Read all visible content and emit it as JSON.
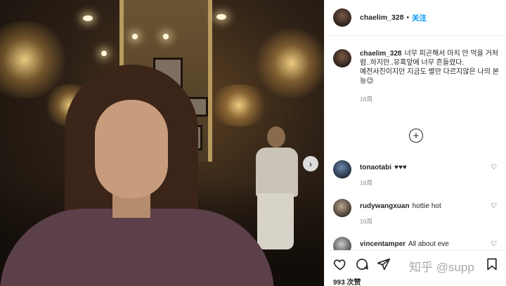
{
  "post": {
    "username": "chaelim_328",
    "separator": "•",
    "follow_label": "关注",
    "caption_lines": [
      "너무 피곤해서 마치 안 먹을 거처럼..하지만..유혹앞에 너무 흔들렸다.",
      "예전사진이지만 지금도 별만 다르지않은 나의 본능😉"
    ],
    "time": "16周"
  },
  "comments": [
    {
      "username": "tonaotabi",
      "text": "♥♥♥",
      "time": "16周"
    },
    {
      "username": "rudywangxuan",
      "text": "hottie hot",
      "time": "16周"
    },
    {
      "username": "vincentamper",
      "text": "All about eve",
      "time": ""
    }
  ],
  "actions": {
    "likes": "993 次赞",
    "watermark": "知乎 @supp"
  },
  "icons": {
    "next": "chevron-right-icon",
    "add": "plus-circle-icon",
    "like": "heart-icon",
    "comment": "comment-icon",
    "share": "paper-plane-icon",
    "save": "bookmark-icon"
  },
  "colors": {
    "follow": "#0095f6",
    "text": "#262626",
    "secondary": "#8e8e8e"
  }
}
